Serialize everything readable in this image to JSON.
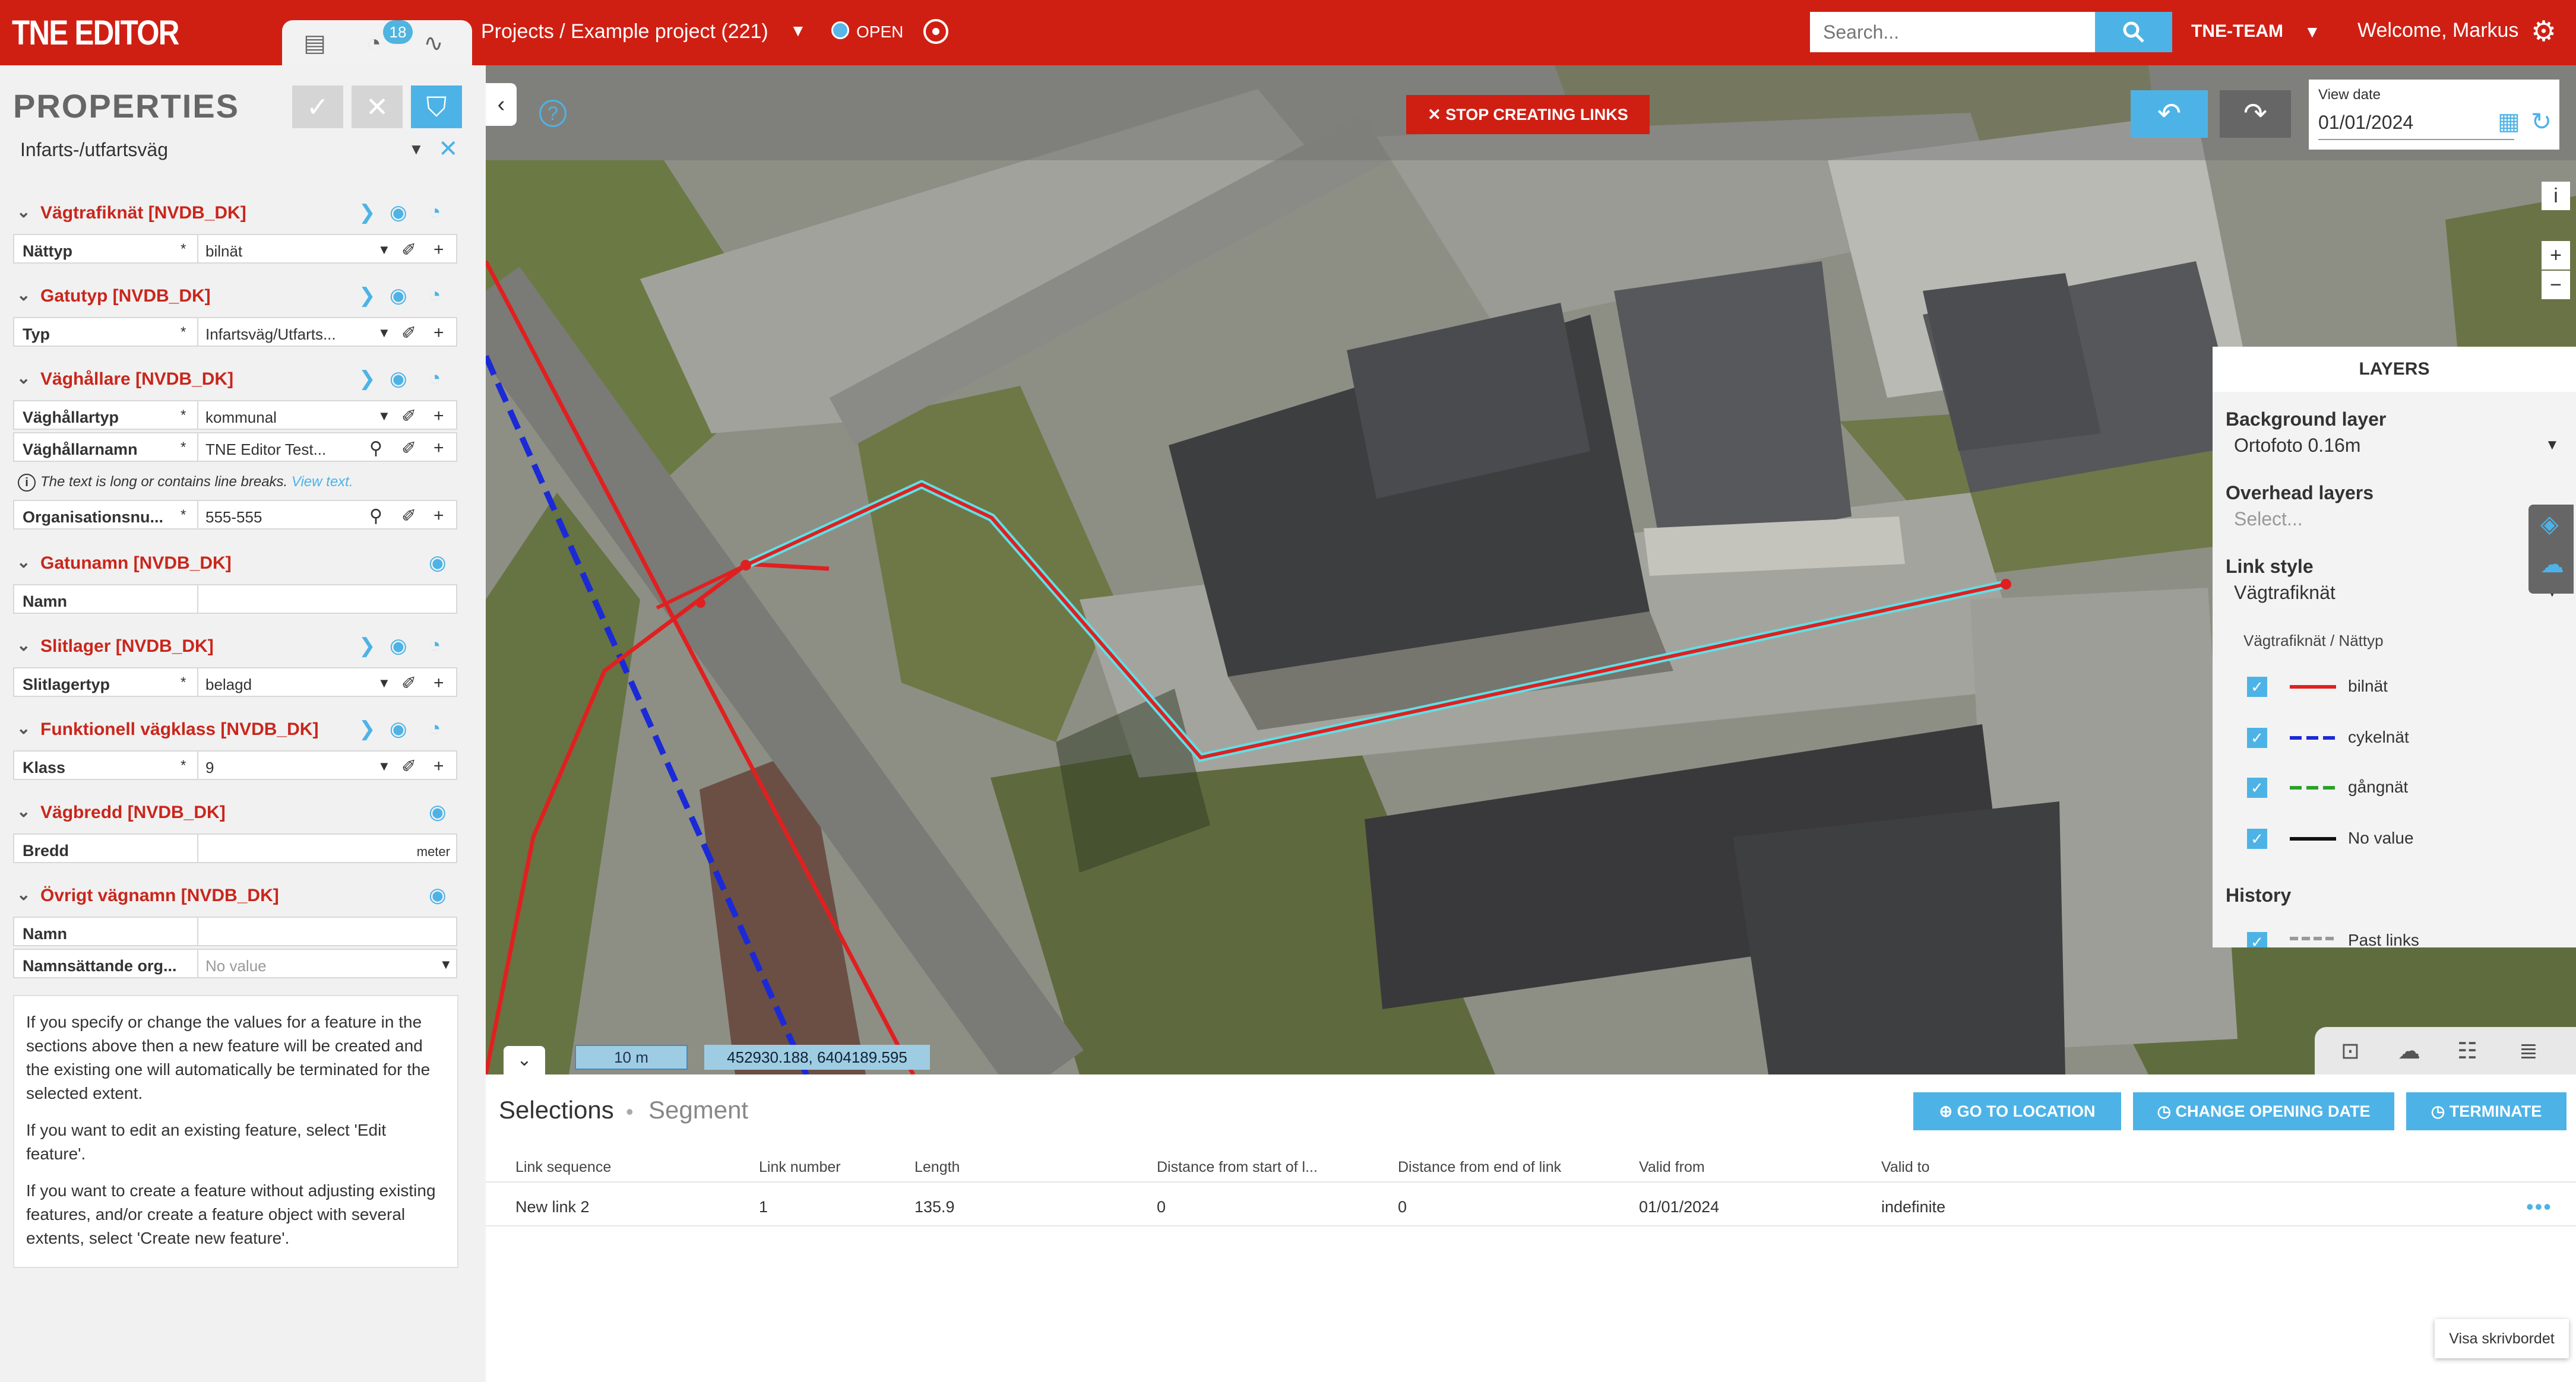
{
  "app": {
    "logo": "TNE EDITOR"
  },
  "header": {
    "tabs_badge": "18",
    "breadcrumb": "Projects / Example project (221)",
    "status": "OPEN",
    "search_placeholder": "Search...",
    "team": "TNE-TEAM",
    "welcome": "Welcome, Markus"
  },
  "properties": {
    "title": "PROPERTIES",
    "feature_type": "Infarts-/utfartsväg",
    "sections": [
      {
        "name": "Vägtrafiknät [NVDB_DK]"
      },
      {
        "name": "Gatutyp [NVDB_DK]"
      },
      {
        "name": "Väghållare [NVDB_DK]"
      },
      {
        "name": "Gatunamn [NVDB_DK]"
      },
      {
        "name": "Slitlager [NVDB_DK]"
      },
      {
        "name": "Funktionell vägklass [NVDB_DK]"
      },
      {
        "name": "Vägbredd [NVDB_DK]"
      },
      {
        "name": "Övrigt vägnamn [NVDB_DK]"
      }
    ],
    "fields": {
      "nattyp": {
        "label": "Nättyp",
        "value": "bilnät"
      },
      "typ": {
        "label": "Typ",
        "value": "Infartsväg/Utfarts..."
      },
      "vaghallartyp": {
        "label": "Väghållartyp",
        "value": "kommunal"
      },
      "vaghallarnamn": {
        "label": "Väghållarnamn",
        "value": "TNE Editor Test..."
      },
      "organisationsnr": {
        "label": "Organisationsnu...",
        "value": "555-555"
      },
      "gatunamn": {
        "label": "Namn",
        "value": ""
      },
      "slitlagertyp": {
        "label": "Slitlagertyp",
        "value": "belagd"
      },
      "klass": {
        "label": "Klass",
        "value": "9"
      },
      "bredd": {
        "label": "Bredd",
        "unit": "meter"
      },
      "ovrigt_namn": {
        "label": "Namn",
        "value": ""
      },
      "namnsattande": {
        "label": "Namnsättande org...",
        "placeholder": "No value"
      }
    },
    "long_text_note": "The text is long or contains line breaks.",
    "long_text_link": "View text.",
    "help": [
      "If you specify or change the values for a feature in the sections above then a new feature will be created and the existing one will automatically be terminated for the selected extent.",
      "If you want to edit an existing feature, select 'Edit feature'.",
      "If you want to create a feature without adjusting existing features, and/or create a feature object with several extents, select 'Create new feature'."
    ]
  },
  "map": {
    "stop_button": "STOP CREATING LINKS",
    "view_date_label": "View date",
    "view_date": "01/01/2024",
    "scale": "10 m",
    "coordinates": "452930.188, 6404189.595"
  },
  "layers": {
    "title": "LAYERS",
    "background_label": "Background layer",
    "background_value": "Ortofoto 0.16m",
    "overhead_label": "Overhead layers",
    "overhead_placeholder": "Select...",
    "link_style_label": "Link style",
    "link_style_value": "Vägtrafiknät",
    "legend_title": "Vägtrafiknät / Nättyp",
    "legend": [
      {
        "label": "bilnät",
        "color": "#e02020"
      },
      {
        "label": "cykelnät",
        "color": "#1b2ad6"
      },
      {
        "label": "gångnät",
        "color": "#2ca02c"
      },
      {
        "label": "No value",
        "color": "#111111"
      }
    ],
    "history_label": "History",
    "history_item": "Past links"
  },
  "selections": {
    "title": "Selections",
    "segment": "Segment",
    "buttons": {
      "goto": "GO TO LOCATION",
      "change": "CHANGE OPENING DATE",
      "terminate": "TERMINATE"
    },
    "columns": [
      "Link sequence",
      "Link number",
      "Length",
      "Distance from start of l...",
      "Distance from end of link",
      "Valid from",
      "Valid to"
    ],
    "rows": [
      [
        "New link 2",
        "1",
        "135.9",
        "0",
        "0",
        "01/01/2024",
        "indefinite"
      ]
    ]
  },
  "desktop_button": "Visa skrivbordet"
}
